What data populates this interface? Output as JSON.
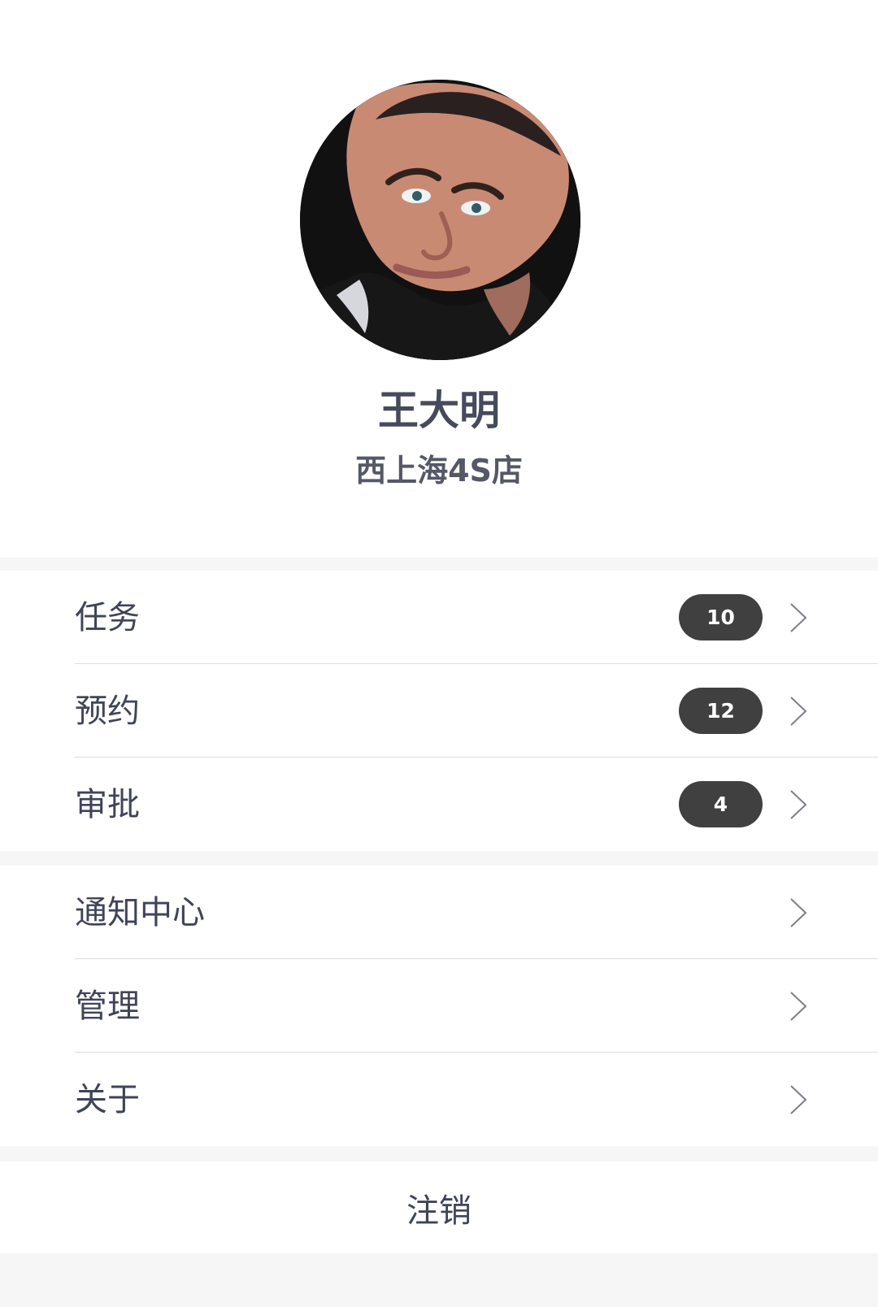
{
  "profile": {
    "name": "王大明",
    "store": "西上海4S店"
  },
  "groups": [
    {
      "items": [
        {
          "label": "任务",
          "badge": "10"
        },
        {
          "label": "预约",
          "badge": "12"
        },
        {
          "label": "审批",
          "badge": "4"
        }
      ]
    },
    {
      "items": [
        {
          "label": "通知中心"
        },
        {
          "label": "管理"
        },
        {
          "label": "关于"
        }
      ]
    }
  ],
  "logout_label": "注销",
  "colors": {
    "background": "#f6f6f7",
    "text": "#3f4459",
    "badge": "#404040",
    "chevron": "#7d7f88"
  },
  "icons": {
    "row_arrow": "chevron-right-icon",
    "avatar": "user-avatar-photo"
  }
}
